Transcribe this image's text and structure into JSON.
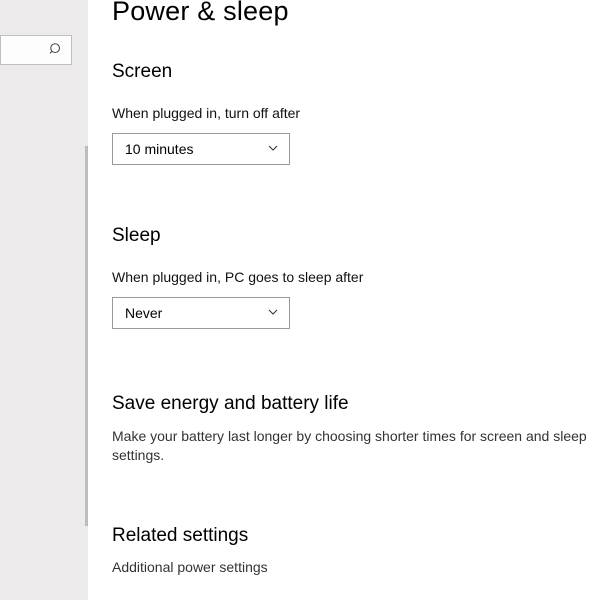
{
  "search": {
    "placeholder": ""
  },
  "page": {
    "title": "Power & sleep"
  },
  "screen": {
    "heading": "Screen",
    "plugged_label": "When plugged in, turn off after",
    "plugged_value": "10 minutes"
  },
  "sleep": {
    "heading": "Sleep",
    "plugged_label": "When plugged in, PC goes to sleep after",
    "plugged_value": "Never"
  },
  "energy": {
    "heading": "Save energy and battery life",
    "text": "Make your battery last longer by choosing shorter times for screen and sleep settings."
  },
  "related": {
    "heading": "Related settings",
    "link": "Additional power settings"
  },
  "partial": {
    "heading": ""
  },
  "icons": {
    "chevron": "chevron-down-icon",
    "search": "search-icon"
  }
}
